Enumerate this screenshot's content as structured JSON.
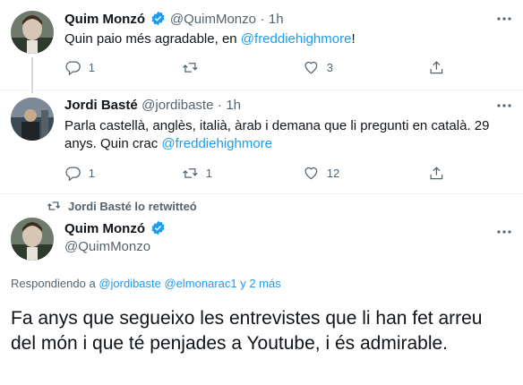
{
  "tweet1": {
    "name": "Quim Monzó",
    "handle": "@QuimMonzo",
    "dot": "·",
    "time": "1h",
    "text_prefix": "Quin paio més agradable, en ",
    "mention": "@freddiehighmore",
    "text_suffix": "!",
    "replies": "1",
    "retweets": "",
    "likes": "3"
  },
  "tweet2": {
    "name": "Jordi Basté",
    "handle": "@jordibaste",
    "dot": "·",
    "time": "1h",
    "text": "Parla castellà, anglès, italià, àrab i demana que li pregunti en català. 29 anys. Quin crac ",
    "mention": "@freddiehighmore",
    "replies": "1",
    "retweets": "1",
    "likes": "12"
  },
  "retweet_banner": "Jordi Basté lo retwitteó",
  "tweet3": {
    "name": "Quim Monzó",
    "handle": "@QuimMonzo",
    "replying_label": "Respondiendo a ",
    "replying_mentions": "@jordibaste @elmonarac1 y 2 más",
    "text": "Fa anys que segueixo les entrevistes que li han fet arreu del món i que té penjades a Youtube, i és admirable."
  },
  "colors": {
    "accent": "#1d9bf0",
    "muted": "#536471"
  },
  "icons": [
    "reply-icon",
    "retweet-icon",
    "like-icon",
    "share-icon",
    "verified-badge-icon",
    "more-icon"
  ]
}
